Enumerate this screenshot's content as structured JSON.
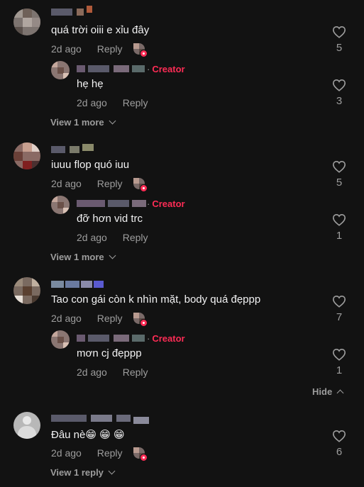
{
  "comments": [
    {
      "text": "quá trời oiii e xỉu đây",
      "time": "2d ago",
      "reply_label": "Reply",
      "likes": "5",
      "reply": {
        "badge": "Creator",
        "text": "hẹ hẹ",
        "time": "2d ago",
        "reply_label": "Reply",
        "likes": "3"
      },
      "view_more": "View 1 more"
    },
    {
      "text": "iuuu flop quó iuu",
      "time": "2d ago",
      "reply_label": "Reply",
      "likes": "5",
      "reply": {
        "badge": "Creator",
        "text": "đỡ hơn vid trc",
        "time": "2d ago",
        "reply_label": "Reply",
        "likes": "1"
      },
      "view_more": "View 1 more"
    },
    {
      "text": "Tao con gái còn k nhìn mặt, body quá đẹppp",
      "time": "2d ago",
      "reply_label": "Reply",
      "likes": "7",
      "reply": {
        "badge": "Creator",
        "text": "mơn cj đẹppp",
        "time": "2d ago",
        "reply_label": "Reply",
        "likes": "1"
      },
      "hide_label": "Hide"
    },
    {
      "text": "Đâu nè😁 😁 😁",
      "time": "2d ago",
      "reply_label": "Reply",
      "likes": "6",
      "view_more": "View 1 reply"
    }
  ],
  "colors": {
    "background": "#121212",
    "text": "#f1f1f2",
    "muted": "#9d9d9d",
    "creator": "#fe2c55"
  },
  "icons": {
    "like": "heart-outline-icon",
    "expand": "chevron-down-icon",
    "collapse": "chevron-up-icon"
  }
}
